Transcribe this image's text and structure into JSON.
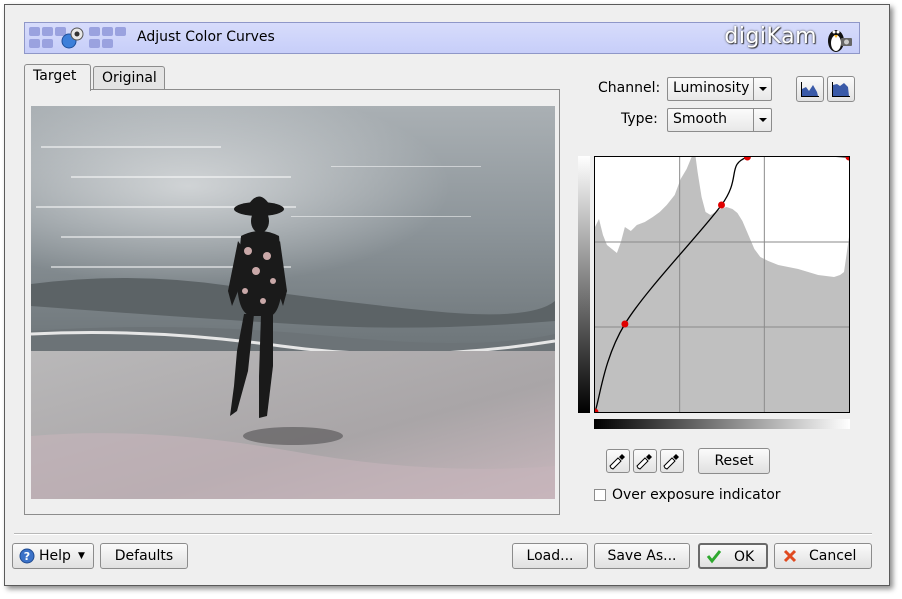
{
  "banner": {
    "title": "Adjust Color Curves",
    "logo": "digiKam"
  },
  "tabs": [
    {
      "label": "Target"
    },
    {
      "label": "Original"
    }
  ],
  "channel": {
    "label": "Channel:",
    "value": "Luminosity"
  },
  "type": {
    "label": "Type:",
    "value": "Smooth"
  },
  "histogram_buttons": [
    {
      "icon": "linear-histogram-icon"
    },
    {
      "icon": "log-histogram-icon"
    }
  ],
  "curve": {
    "points": [
      [
        0,
        0
      ],
      [
        30,
        88
      ],
      [
        127,
        207
      ],
      [
        153,
        255
      ],
      [
        255,
        255
      ]
    ]
  },
  "pickers": [
    {
      "icon": "black-point-picker-icon"
    },
    {
      "icon": "gray-point-picker-icon"
    },
    {
      "icon": "white-point-picker-icon"
    }
  ],
  "reset_label": "Reset",
  "overexposure_label": "Over exposure indicator",
  "footer": {
    "help_label": "Help",
    "defaults_label": "Defaults",
    "load_label": "Load...",
    "save_as_label": "Save As...",
    "ok_label": "OK",
    "cancel_label": "Cancel"
  }
}
